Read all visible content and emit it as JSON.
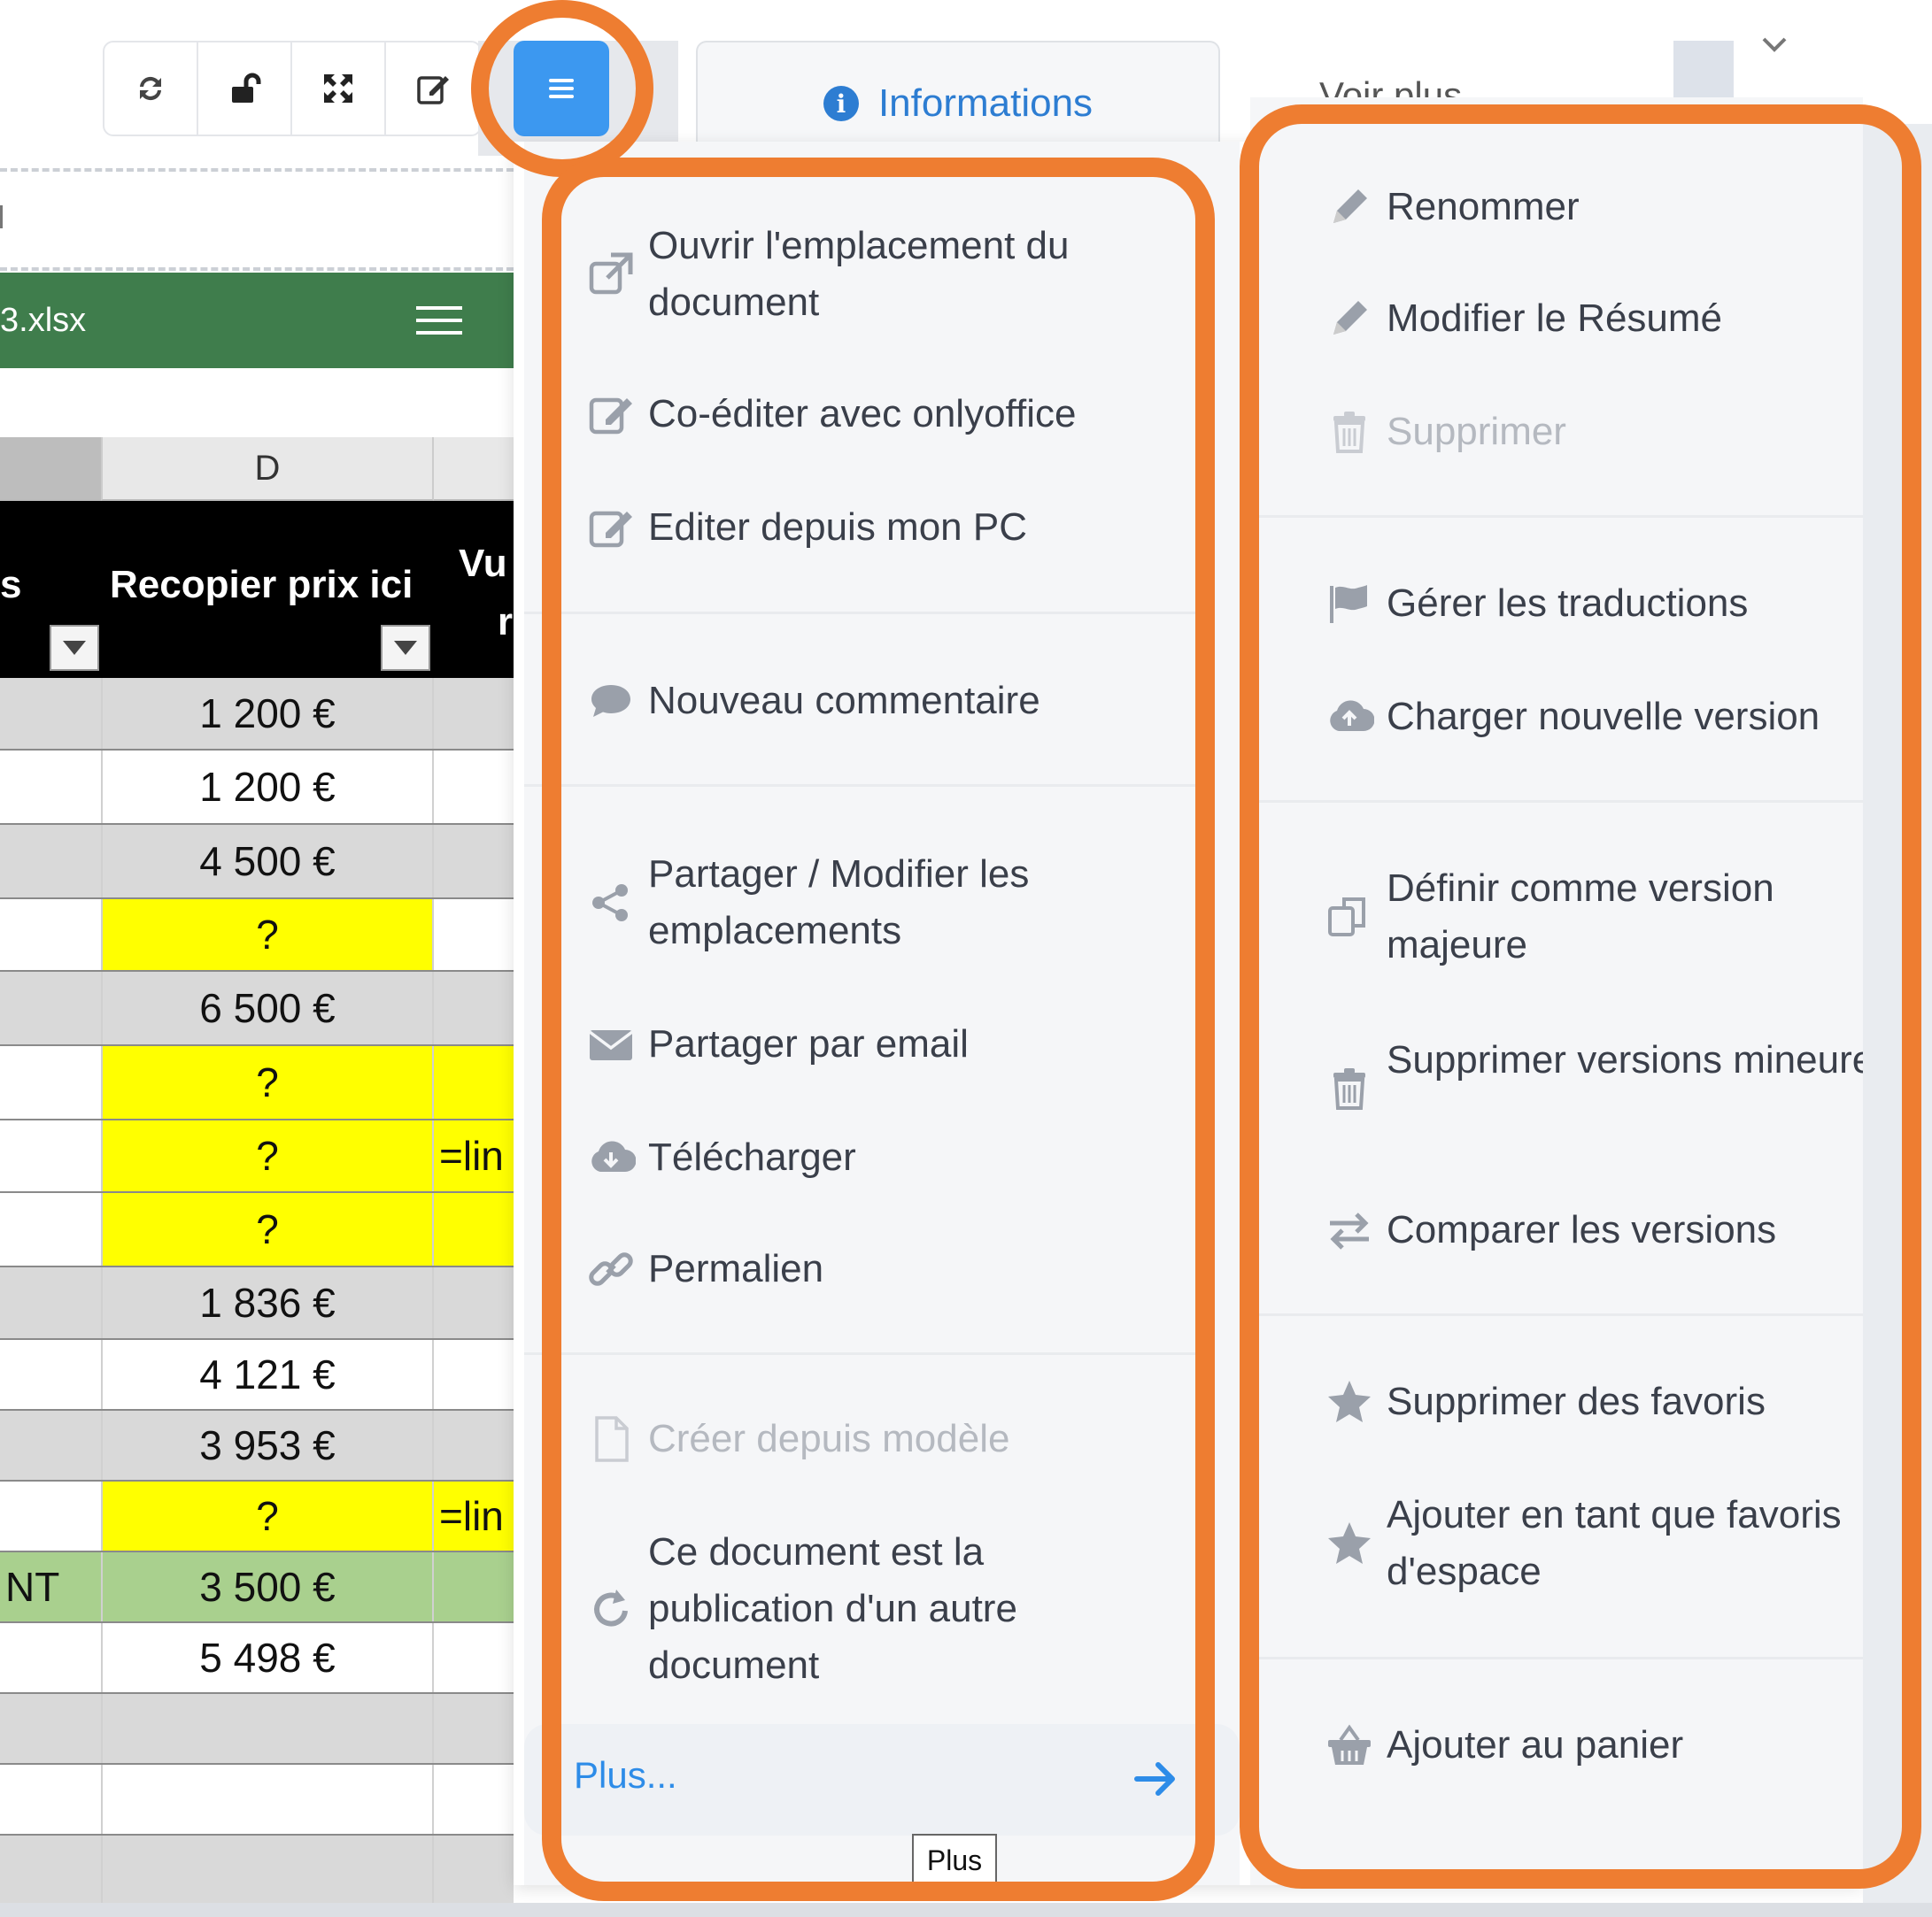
{
  "toolbar": {
    "buttons": [
      {
        "name": "refresh-icon"
      },
      {
        "name": "unlock-icon"
      },
      {
        "name": "fullscreen-icon"
      },
      {
        "name": "edit-icon"
      }
    ],
    "menu_button": "hamburger-icon"
  },
  "tabs": {
    "info": "Informations",
    "voir_plus": "Voir plus"
  },
  "file": {
    "name": "3.xlsx"
  },
  "sheet": {
    "col_d": "D",
    "header_left_fragment": "s",
    "header_d": "Recopier prix ici",
    "header_e_line1": "Vu",
    "header_e_line2": "r",
    "rows": [
      {
        "a": "",
        "d": "1 200 €",
        "e": "",
        "fill": "gray"
      },
      {
        "a": "",
        "d": "1 200 €",
        "e": "",
        "fill": "white"
      },
      {
        "a": "",
        "d": "4 500 €",
        "e": "",
        "fill": "gray"
      },
      {
        "a": "",
        "d": "?",
        "e": "",
        "fill": "yellow-d"
      },
      {
        "a": "",
        "d": "6 500 €",
        "e": "",
        "fill": "gray"
      },
      {
        "a": "",
        "d": "?",
        "e": "",
        "fill": "yellow"
      },
      {
        "a": "",
        "d": "?",
        "e": "=lin",
        "fill": "yellow"
      },
      {
        "a": "",
        "d": "?",
        "e": "",
        "fill": "yellow"
      },
      {
        "a": "",
        "d": "1 836 €",
        "e": "",
        "fill": "gray"
      },
      {
        "a": "",
        "d": "4 121 €",
        "e": "",
        "fill": "white"
      },
      {
        "a": "",
        "d": "3 953 €",
        "e": "",
        "fill": "gray"
      },
      {
        "a": "",
        "d": "?",
        "e": "=lin",
        "fill": "yellow"
      },
      {
        "a": "NT",
        "d": "3 500 €",
        "e": "",
        "fill": "green"
      },
      {
        "a": "",
        "d": "5 498 €",
        "e": "",
        "fill": "white"
      },
      {
        "a": "",
        "d": "",
        "e": "",
        "fill": "gray"
      },
      {
        "a": "",
        "d": "",
        "e": "",
        "fill": "white"
      },
      {
        "a": "",
        "d": "",
        "e": "",
        "fill": "gray"
      }
    ]
  },
  "menu_left": [
    {
      "label": "Ouvrir l'emplacement du document",
      "icon": "external-link-icon",
      "disabled": false
    },
    {
      "label": "Co-éditer avec onlyoffice",
      "icon": "edit-icon",
      "disabled": false
    },
    {
      "label": "Editer depuis mon PC",
      "icon": "edit-icon",
      "disabled": false
    },
    {
      "label": "Nouveau commentaire",
      "icon": "comment-icon",
      "disabled": false
    },
    {
      "label": "Partager / Modifier les emplacements",
      "icon": "share-icon",
      "disabled": false
    },
    {
      "label": "Partager par email",
      "icon": "envelope-icon",
      "disabled": false
    },
    {
      "label": "Télécharger",
      "icon": "cloud-download-icon",
      "disabled": false
    },
    {
      "label": "Permalien",
      "icon": "link-icon",
      "disabled": false
    },
    {
      "label": "Créer depuis modèle",
      "icon": "file-icon",
      "disabled": true
    },
    {
      "label": "Ce document est la publication d'un autre document",
      "icon": "redo-icon",
      "disabled": false
    }
  ],
  "plus": {
    "label": "Plus...",
    "tooltip": "Plus"
  },
  "menu_right": [
    {
      "label": "Renommer",
      "icon": "pencil-icon",
      "disabled": false
    },
    {
      "label": "Modifier le Résumé",
      "icon": "pencil-icon",
      "disabled": false
    },
    {
      "label": "Supprimer",
      "icon": "trash-icon",
      "disabled": true
    },
    {
      "label": "Gérer les traductions",
      "icon": "flag-icon",
      "disabled": false
    },
    {
      "label": "Charger nouvelle version",
      "icon": "cloud-upload-icon",
      "disabled": false
    },
    {
      "label": "Définir comme version majeure",
      "icon": "copy-icon",
      "disabled": false
    },
    {
      "label": "Supprimer versions mineures",
      "icon": "trash-icon",
      "disabled": false
    },
    {
      "label": "Comparer les versions",
      "icon": "exchange-icon",
      "disabled": false
    },
    {
      "label": "Supprimer des favoris",
      "icon": "star-icon",
      "disabled": false
    },
    {
      "label": "Ajouter en tant que favoris d'espace",
      "icon": "star-icon",
      "disabled": false
    },
    {
      "label": "Ajouter au panier",
      "icon": "basket-icon",
      "disabled": false
    }
  ],
  "colors": {
    "accent": "#3c98f0",
    "link": "#2d7dd2",
    "highlight": "#ee7d31",
    "sheet_green": "#3f7d4c",
    "cell_yellow": "#ffff00",
    "cell_gray": "#d9d9d9",
    "cell_green": "#a9d08e"
  }
}
